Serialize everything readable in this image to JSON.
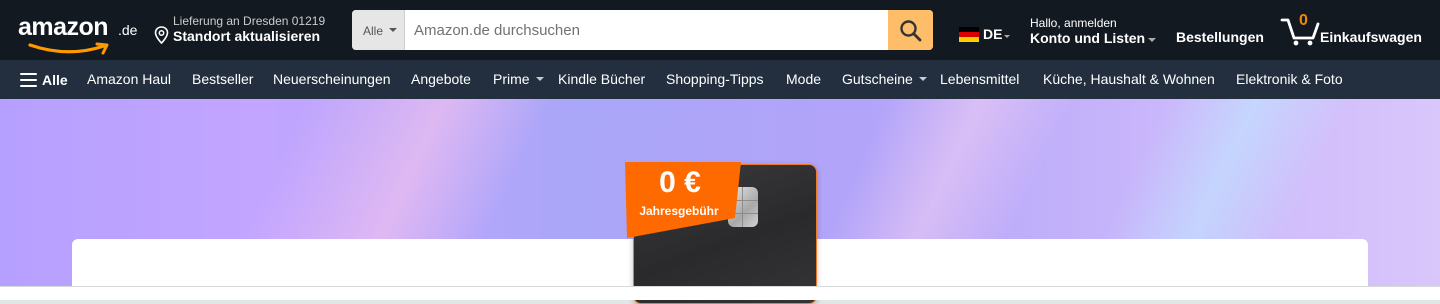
{
  "header": {
    "logo": {
      "word": "amazon",
      "tld": ".de"
    },
    "delivery": {
      "line1": "Lieferung an Dresden 01219",
      "line2": "Standort aktualisieren"
    },
    "search": {
      "scope": "Alle",
      "placeholder": "Amazon.de durchsuchen"
    },
    "language": {
      "code": "DE",
      "flag_colors": [
        "#000000",
        "#dd0000",
        "#ffce00"
      ]
    },
    "account": {
      "greeting": "Hallo, anmelden",
      "label": "Konto und Listen"
    },
    "orders": "Bestellungen",
    "cart": {
      "count": "0",
      "label": "Einkaufswagen"
    }
  },
  "subnav": {
    "all": "Alle",
    "items": [
      {
        "label": "Amazon Haul"
      },
      {
        "label": "Bestseller"
      },
      {
        "label": "Neuerscheinungen"
      },
      {
        "label": "Angebote"
      },
      {
        "label": "Prime",
        "dropdown": true
      },
      {
        "label": "Kindle Bücher"
      },
      {
        "label": "Shopping-Tipps"
      },
      {
        "label": "Mode"
      },
      {
        "label": "Gutscheine",
        "dropdown": true
      },
      {
        "label": "Lebensmittel"
      },
      {
        "label": "Küche, Haushalt & Wohnen"
      },
      {
        "label": "Elektronik & Foto"
      }
    ]
  },
  "hero": {
    "badge": {
      "amount": "0 €",
      "text": "Jahresgebühr"
    }
  },
  "colors": {
    "nav_dark": "#131921",
    "nav_sub": "#232f3e",
    "search_button": "#febd69",
    "badge_orange": "#ff6a00",
    "cart_count": "#f08804"
  }
}
